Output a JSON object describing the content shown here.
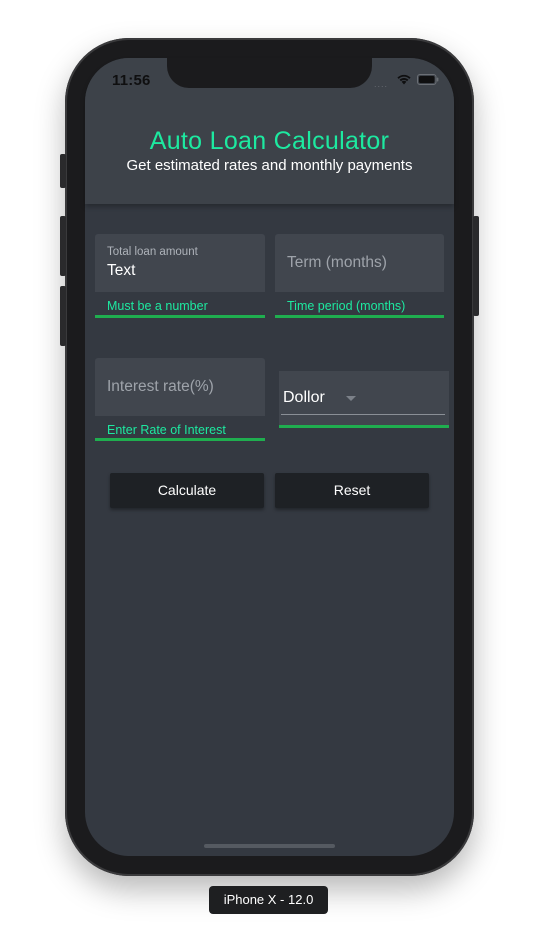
{
  "status_bar": {
    "time": "11:56",
    "signal": "....",
    "icons": [
      "wifi-icon",
      "battery-icon"
    ]
  },
  "header": {
    "title": "Auto Loan Calculator",
    "subtitle": "Get estimated rates and monthly payments"
  },
  "form": {
    "loan_amount": {
      "label": "Total loan amount",
      "value": "Text",
      "helper": "Must be a number"
    },
    "term": {
      "placeholder": "Term (months)",
      "helper": "Time period (months)"
    },
    "interest": {
      "placeholder": "Interest rate(%)",
      "helper": "Enter Rate of Interest"
    },
    "currency": {
      "selected": "Dollor"
    }
  },
  "buttons": {
    "calculate": "Calculate",
    "reset": "Reset"
  },
  "device_label": "iPhone X - 12.0",
  "colors": {
    "accent": "#1de9a0",
    "underline": "#1fae4f",
    "screen_bg": "#343941",
    "field_bg": "#41464e",
    "button_bg": "#1e2125"
  }
}
